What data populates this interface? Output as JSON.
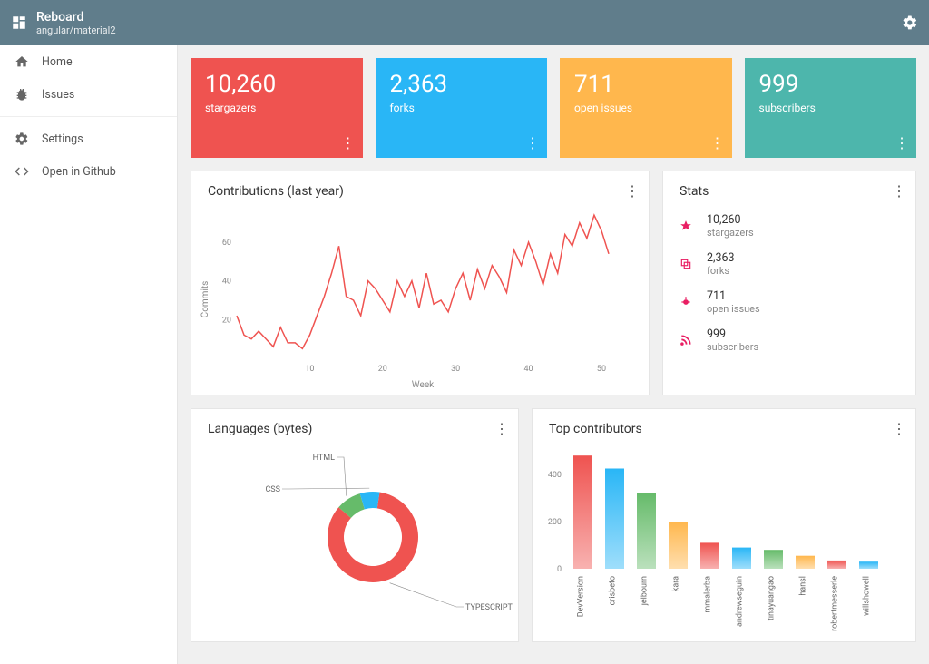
{
  "header": {
    "title": "Reboard",
    "subtitle": "angular/material2"
  },
  "sidebar": {
    "items": [
      {
        "label": "Home",
        "icon": "home"
      },
      {
        "label": "Issues",
        "icon": "bug"
      },
      {
        "label": "Settings",
        "icon": "gear"
      },
      {
        "label": "Open in Github",
        "icon": "code"
      }
    ]
  },
  "stat_cards": [
    {
      "value": "10,260",
      "label": "stargazers",
      "color": "#ef5350"
    },
    {
      "value": "2,363",
      "label": "forks",
      "color": "#29b6f6"
    },
    {
      "value": "711",
      "label": "open issues",
      "color": "#ffb74d"
    },
    {
      "value": "999",
      "label": "subscribers",
      "color": "#4db6ac"
    }
  ],
  "contributions": {
    "title": "Contributions (last year)"
  },
  "stats_panel": {
    "title": "Stats",
    "items": [
      {
        "value": "10,260",
        "label": "stargazers",
        "icon": "star"
      },
      {
        "value": "2,363",
        "label": "forks",
        "icon": "copy"
      },
      {
        "value": "711",
        "label": "open issues",
        "icon": "bug"
      },
      {
        "value": "999",
        "label": "subscribers",
        "icon": "rss"
      }
    ]
  },
  "languages": {
    "title": "Languages (bytes)"
  },
  "top_contributors": {
    "title": "Top contributors"
  },
  "chart_data": {
    "contributions": {
      "type": "line",
      "xlabel": "Week",
      "ylabel": "Commits",
      "x_ticks": [
        10,
        20,
        30,
        40,
        50
      ],
      "y_ticks": [
        20,
        40,
        60
      ],
      "values": [
        22,
        12,
        10,
        14,
        10,
        6,
        16,
        8,
        8,
        5,
        12,
        22,
        32,
        44,
        58,
        32,
        30,
        22,
        40,
        36,
        30,
        24,
        40,
        32,
        40,
        26,
        44,
        28,
        30,
        24,
        36,
        44,
        30,
        46,
        36,
        48,
        42,
        34,
        56,
        48,
        60,
        50,
        38,
        54,
        44,
        64,
        58,
        70,
        62,
        74,
        66,
        54
      ]
    },
    "languages": {
      "type": "pie",
      "series": [
        {
          "name": "TYPESCRIPT",
          "value": 84,
          "color": "#ef5350"
        },
        {
          "name": "HTML",
          "value": 9,
          "color": "#66bb6a"
        },
        {
          "name": "CSS",
          "value": 7,
          "color": "#29b6f6"
        }
      ]
    },
    "contributors": {
      "type": "bar",
      "ylabel": "",
      "y_ticks": [
        0,
        200,
        400
      ],
      "categories": [
        "DevVersion",
        "crisbeto",
        "jelbourn",
        "kara",
        "mmalerba",
        "andrewseguin",
        "tinayuangao",
        "hansl",
        "robertmesserle",
        "willshowell"
      ],
      "values": [
        480,
        425,
        320,
        200,
        110,
        90,
        80,
        55,
        35,
        30
      ],
      "colors": [
        "#ef5350",
        "#29b6f6",
        "#66bb6a",
        "#ffb74d",
        "#ef5350",
        "#29b6f6",
        "#66bb6a",
        "#ffb74d",
        "#ef5350",
        "#29b6f6"
      ]
    }
  }
}
